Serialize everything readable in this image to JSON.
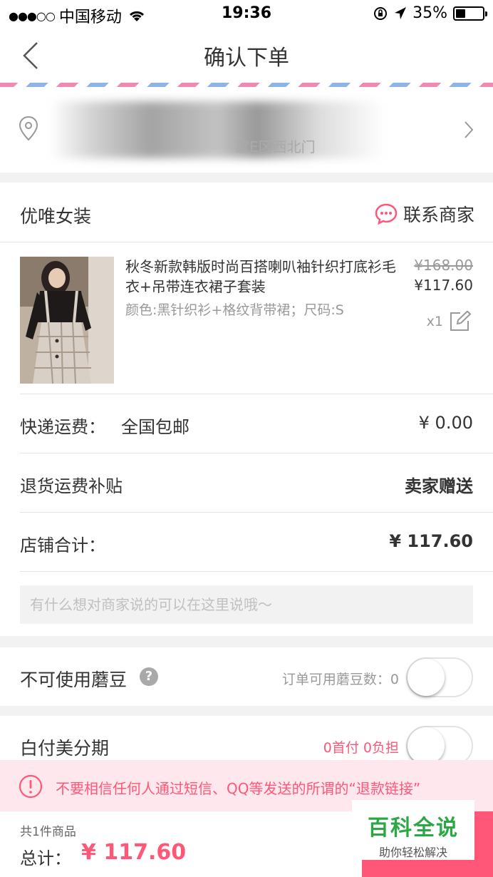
{
  "status_bar": {
    "signal": "●●●○○",
    "carrier": "中国移动",
    "time": "19:36",
    "battery_text": "35%",
    "battery_level": 0.35
  },
  "nav": {
    "title": "确认下单"
  },
  "address": {
    "visible_fragment": "家E区西北门"
  },
  "shop": {
    "name": "优唯女装",
    "contact_label": "联系商家"
  },
  "product": {
    "name": "秋冬新款韩版时尚百搭喇叭袖针织打底衫毛衣+吊带连衣裙子套装",
    "spec": "颜色:黑针织衫+格纹背带裙；尺码:S",
    "original_price": "¥168.00",
    "price": "¥117.60",
    "quantity": "x1"
  },
  "rows": {
    "shipping_label": "快递运费：",
    "shipping_mid": "全国包邮",
    "shipping_value": "¥ 0.00",
    "return_label": "退货运费补贴",
    "return_value": "卖家赠送",
    "subtotal_label": "店铺合计：",
    "subtotal_value": "¥ 117.60"
  },
  "memo": {
    "placeholder": "有什么想对商家说的可以在这里说哦～"
  },
  "beans": {
    "label": "不可使用蘑豆",
    "help": "?",
    "info": "订单可用蘑豆数：0",
    "enabled": false
  },
  "installment": {
    "label": "白付美分期",
    "info": "0首付 0负担",
    "enabled": false
  },
  "warning": {
    "text": "不要相信任何人通过短信、QQ等发送的所谓的“退款链接”"
  },
  "bottom": {
    "count": "共1件商品",
    "total_label": "总计：",
    "total_value": "¥ 117.60"
  },
  "watermark": {
    "title": "百科全说",
    "subtitle": "助你轻松解决"
  },
  "colors": {
    "accent": "#ff5777",
    "warning_bg": "#ffe7ee",
    "watermark_green": "#2aa845"
  },
  "icons": [
    "wifi-icon",
    "orientation-lock-icon",
    "location-arrow-icon",
    "battery-icon",
    "back-arrow-icon",
    "location-pin-icon",
    "chevron-right-icon",
    "chat-bubble-icon",
    "edit-icon",
    "help-icon",
    "alert-icon"
  ]
}
